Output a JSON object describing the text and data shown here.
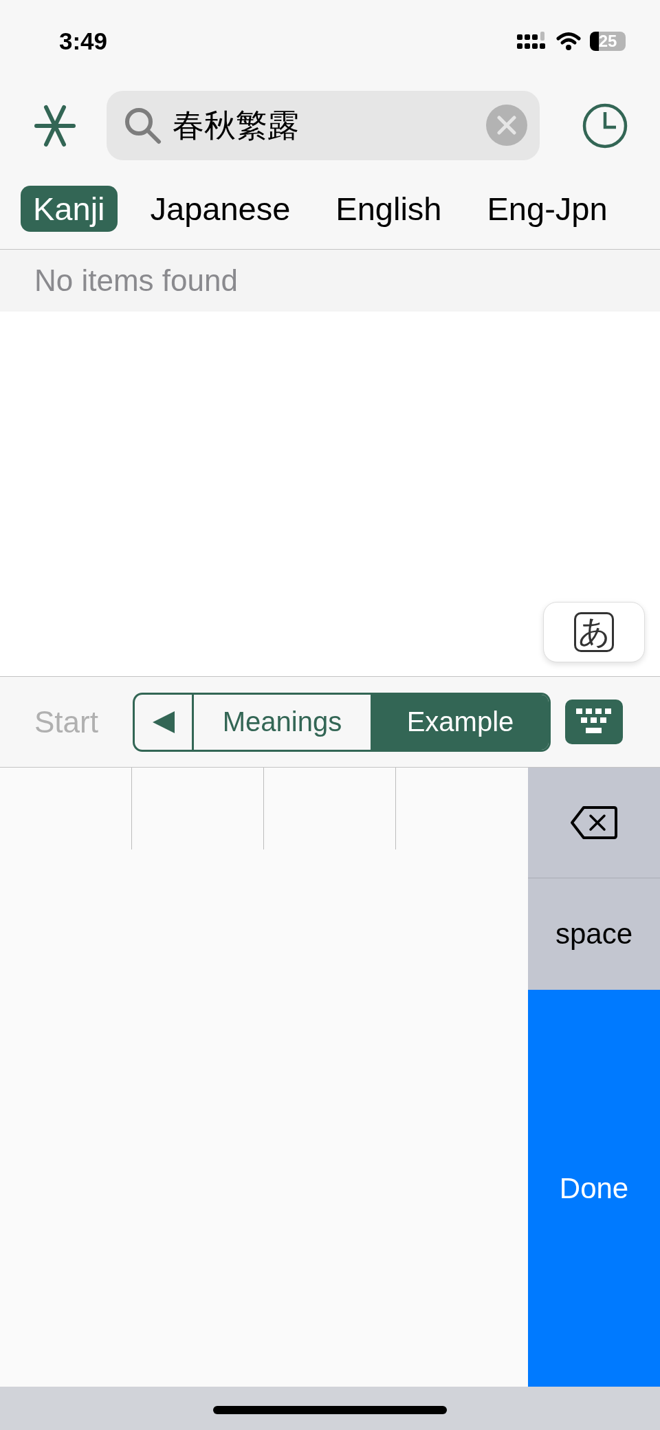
{
  "status_bar": {
    "time": "3:49",
    "battery": "25"
  },
  "search": {
    "value": "春秋繁露"
  },
  "tabs": [
    {
      "label": "Kanji",
      "selected": true
    },
    {
      "label": "Japanese",
      "selected": false
    },
    {
      "label": "English",
      "selected": false
    },
    {
      "label": "Eng-Jpn",
      "selected": false
    }
  ],
  "results": {
    "message": "No items found"
  },
  "input_mode_button": {
    "label": "あ"
  },
  "toolbar": {
    "start": {
      "label": "Start",
      "disabled": true
    },
    "segments": [
      {
        "label": "Meanings",
        "selected": false
      },
      {
        "label": "Example",
        "selected": true
      }
    ]
  },
  "keyboard": {
    "keys": [
      {
        "kind": "backspace"
      },
      {
        "kind": "space",
        "label": "space"
      },
      {
        "kind": "done",
        "label": "Done"
      }
    ]
  }
}
